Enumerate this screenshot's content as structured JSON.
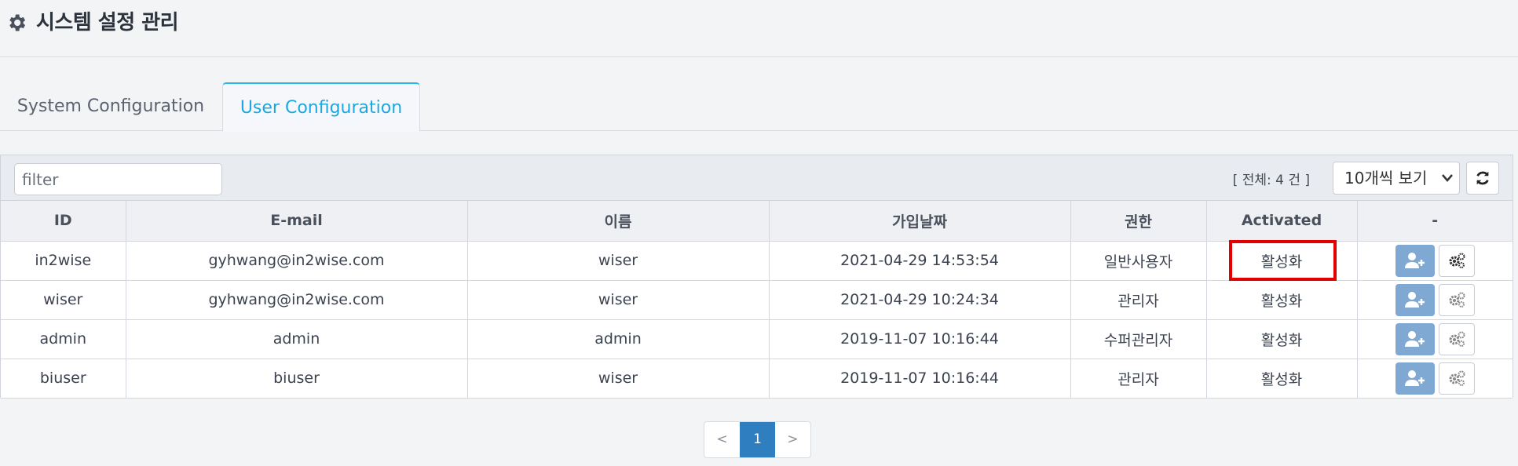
{
  "header": {
    "title": "시스템 설정 관리",
    "icon": "gear-icon"
  },
  "tabs": [
    {
      "label": "System Configuration",
      "active": false
    },
    {
      "label": "User Configuration",
      "active": true
    }
  ],
  "toolbar": {
    "filter_placeholder": "filter",
    "count_label": "[ 전체: 4 건 ]",
    "page_size": "10개씩 보기",
    "refresh_icon": "refresh-icon"
  },
  "table": {
    "columns": [
      "ID",
      "E-mail",
      "이름",
      "가입날짜",
      "권한",
      "Activated",
      "-"
    ],
    "rows": [
      {
        "id": "in2wise",
        "email": "gyhwang@in2wise.com",
        "name": "wiser",
        "joined": "2021-04-29 14:53:54",
        "role": "일반사용자",
        "activated": "활성화"
      },
      {
        "id": "wiser",
        "email": "gyhwang@in2wise.com",
        "name": "wiser",
        "joined": "2021-04-29 10:24:34",
        "role": "관리자",
        "activated": "활성화"
      },
      {
        "id": "admin",
        "email": "admin",
        "name": "admin",
        "joined": "2019-11-07 10:16:44",
        "role": "수퍼관리자",
        "activated": "활성화"
      },
      {
        "id": "biuser",
        "email": "biuser",
        "name": "wiser",
        "joined": "2019-11-07 10:16:44",
        "role": "관리자",
        "activated": "활성화"
      }
    ]
  },
  "pagination": {
    "prev": "<",
    "current": "1",
    "next": ">"
  },
  "colors": {
    "accent": "#1ba8e0",
    "highlight": "#e40000",
    "add_button": "#7fa9d3",
    "active_page": "#2f7fc0"
  }
}
